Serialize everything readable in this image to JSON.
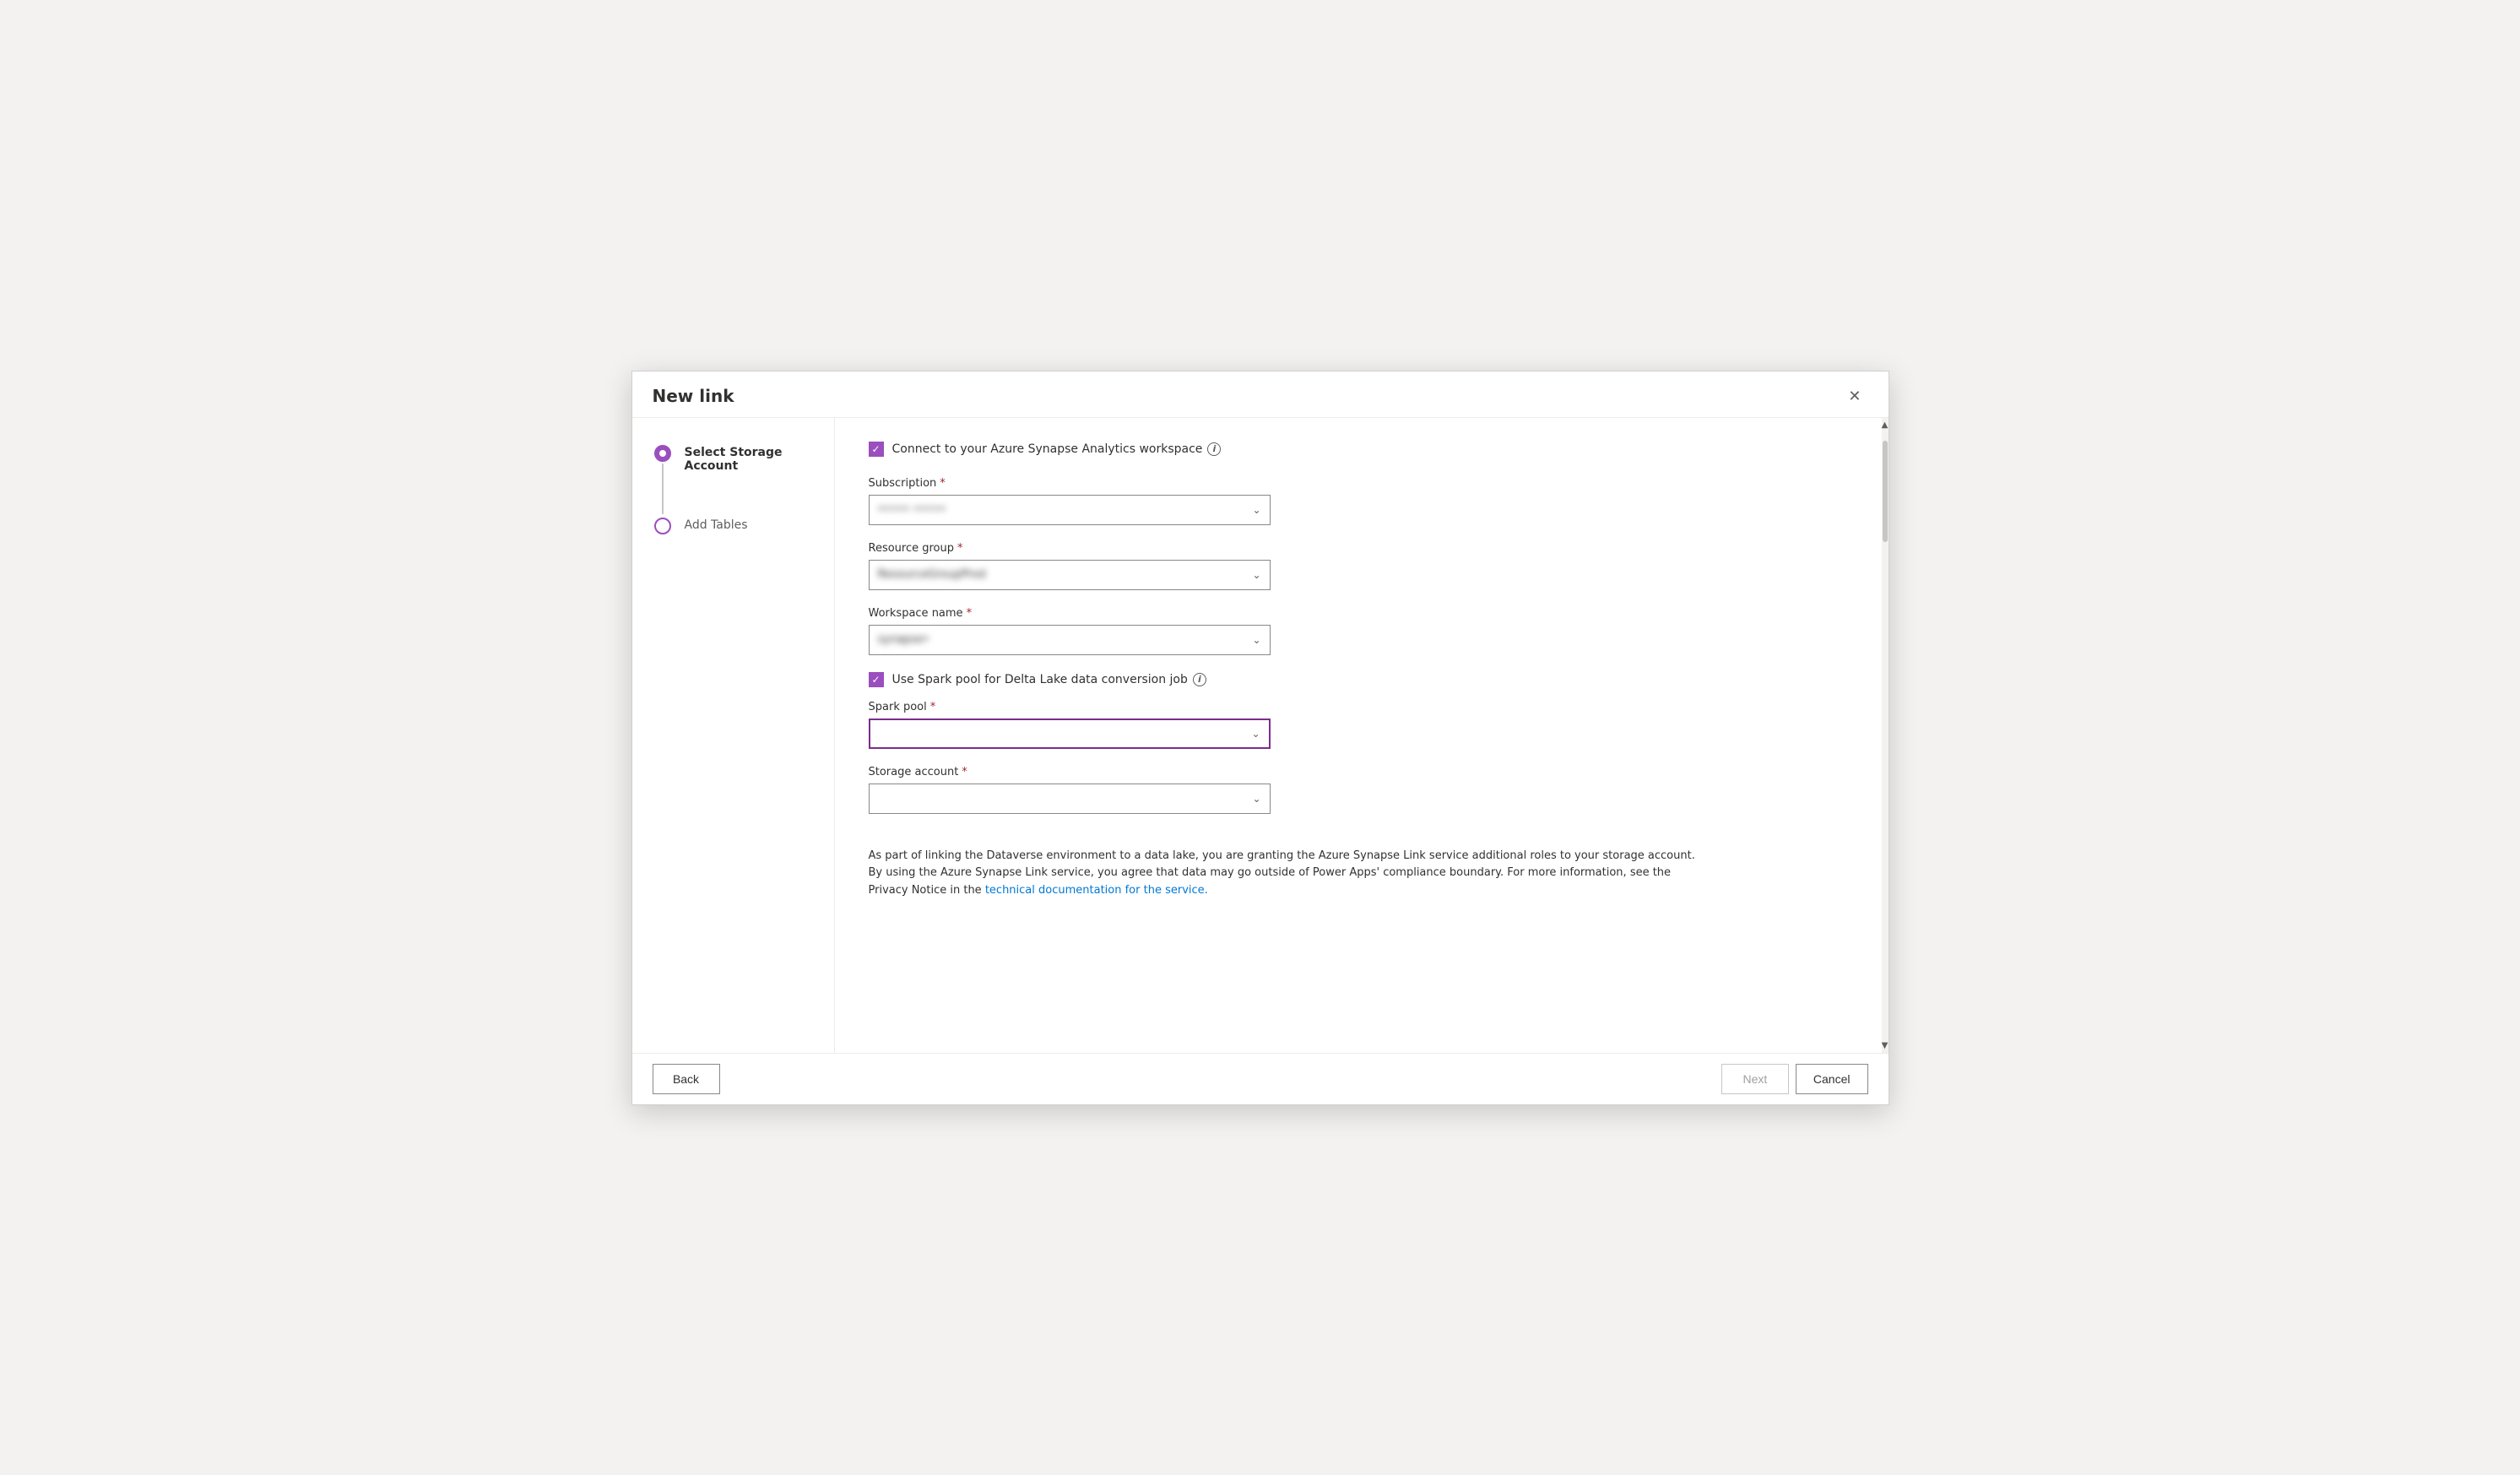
{
  "dialog": {
    "title": "New link",
    "close_label": "✕"
  },
  "sidebar": {
    "steps": [
      {
        "label": "Select Storage Account",
        "active": true,
        "state": "filled"
      },
      {
        "label": "Add Tables",
        "active": false,
        "state": "empty"
      }
    ]
  },
  "form": {
    "connect_checkbox_label": "Connect to your Azure Synapse Analytics workspace",
    "subscription_label": "Subscription",
    "subscription_value": "••••• •••••",
    "resource_group_label": "Resource group",
    "resource_group_value": "ResourceGroupProd",
    "workspace_name_label": "Workspace name",
    "workspace_name_value": "synapse•",
    "spark_pool_checkbox_label": "Use Spark pool for Delta Lake data conversion job",
    "spark_pool_label": "Spark pool",
    "spark_pool_value": "",
    "storage_account_label": "Storage account",
    "storage_account_value": "",
    "info_text_1": "As part of linking the Dataverse environment to a data lake, you are granting the Azure Synapse Link service additional roles to your storage account. By using the Azure Synapse Link service, you agree that data may go outside of Power Apps' compliance boundary. For more information, see the Privacy Notice in the ",
    "info_link_text": "technical documentation for the service.",
    "info_link_href": "#"
  },
  "footer": {
    "back_label": "Back",
    "next_label": "Next",
    "cancel_label": "Cancel"
  },
  "icons": {
    "chevron_down": "⌄",
    "info": "i",
    "checkmark": "✓",
    "close": "✕",
    "scroll_up": "▲",
    "scroll_down": "▼"
  }
}
